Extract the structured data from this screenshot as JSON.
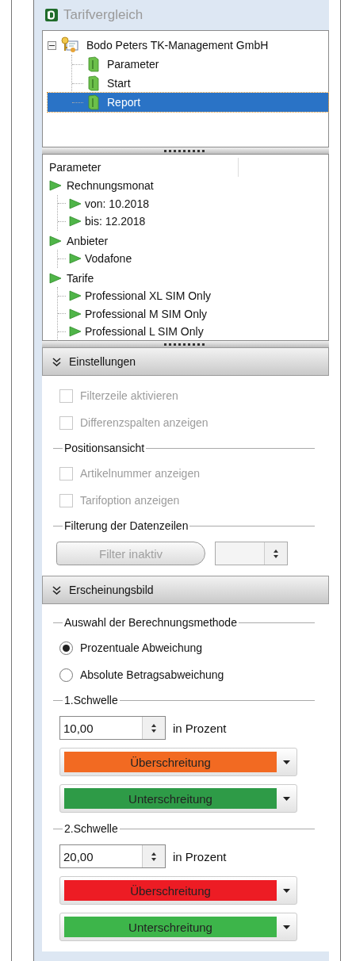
{
  "window": {
    "title": "Tarifvergleich",
    "disabled": true
  },
  "company_tree": [
    {
      "label": "Bodo Peters TK-Management GmbH",
      "expanded": true,
      "selected": false,
      "children": [
        {
          "label": "Parameter",
          "selected": false
        },
        {
          "label": "Start",
          "selected": false
        },
        {
          "label": "Report",
          "selected": true
        }
      ]
    }
  ],
  "parameter_tree": {
    "header": "Parameter",
    "items": [
      {
        "label": "Rechnungsmonat",
        "children": [
          {
            "label": "von: 10.2018"
          },
          {
            "label": "bis: 12.2018"
          }
        ]
      },
      {
        "label": "Anbieter",
        "children": [
          {
            "label": "Vodafone"
          }
        ]
      },
      {
        "label": "Tarife",
        "children": [
          {
            "label": "Professional XL SIM Only"
          },
          {
            "label": "Professional M SIM Only"
          },
          {
            "label": "Professional L SIM Only"
          }
        ]
      }
    ]
  },
  "sections": [
    {
      "title": "Einstellungen",
      "expanded": true,
      "items": [
        {
          "kind": "checkbox",
          "label": "Filterzeile aktivieren",
          "checked": false,
          "disabled": true
        },
        {
          "kind": "checkbox",
          "label": "Differenzspalten anzeigen",
          "checked": false,
          "disabled": true
        },
        {
          "kind": "group",
          "label": "Positionsansicht"
        },
        {
          "kind": "checkbox",
          "label": "Artikelnummer anzeigen",
          "checked": false,
          "disabled": true
        },
        {
          "kind": "checkbox",
          "label": "Tarifoption anzeigen",
          "checked": false,
          "disabled": true
        },
        {
          "kind": "group",
          "label": "Filterung der Datenzeilen"
        },
        {
          "kind": "filter",
          "button": "Filter inaktiv",
          "disabled": true
        }
      ]
    },
    {
      "title": "Erscheinungsbild",
      "expanded": true,
      "items": [
        {
          "kind": "group",
          "label": "Auswahl der Berechnungsmethode"
        },
        {
          "kind": "radio",
          "label": "Prozentuale Abweichung",
          "selected": true
        },
        {
          "kind": "radio",
          "label": "Absolute Betragsabweichung",
          "selected": false
        },
        {
          "kind": "group",
          "label": "1.Schwelle"
        },
        {
          "kind": "spin",
          "value": "10,00",
          "unit": "in Prozent"
        },
        {
          "kind": "color",
          "label": "Überschreitung",
          "color": "#f26a22"
        },
        {
          "kind": "color",
          "label": "Unterschreitung",
          "color": "#2e9b47"
        },
        {
          "kind": "group",
          "label": "2.Schwelle"
        },
        {
          "kind": "spin",
          "value": "20,00",
          "unit": "in Prozent"
        },
        {
          "kind": "color",
          "label": "Überschreitung",
          "color": "#ed1c24"
        },
        {
          "kind": "color",
          "label": "Unterschreitung",
          "color": "#3db54a"
        }
      ]
    }
  ]
}
